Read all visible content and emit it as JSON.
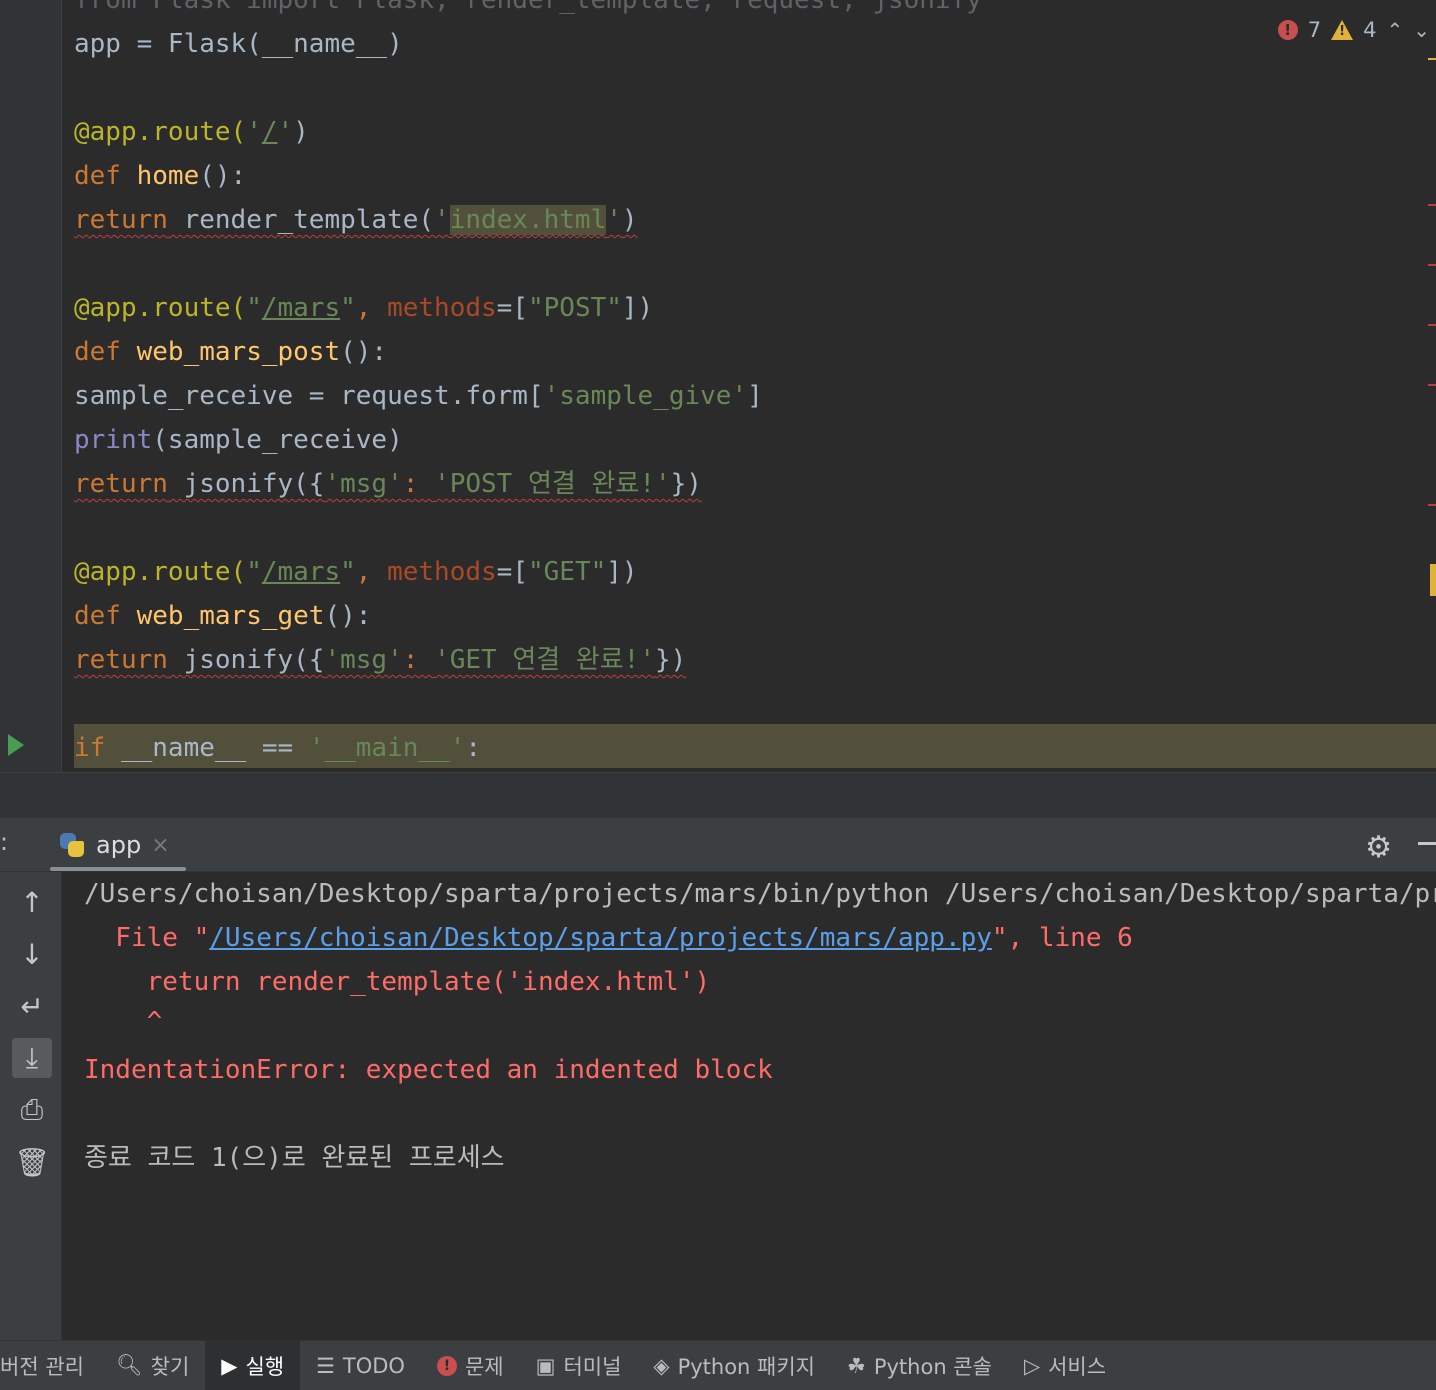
{
  "editor": {
    "lines": [
      {
        "segments": [
          {
            "t": "from Flask import Flask, render_template, request, jsonify",
            "c": "ghost"
          }
        ]
      },
      {
        "segments": [
          {
            "t": "app = Flask(__name__)",
            "c": "op"
          }
        ]
      },
      {
        "segments": []
      },
      {
        "segments": [
          {
            "t": "@app.route(",
            "c": "dec"
          },
          {
            "t": "'",
            "c": "str"
          },
          {
            "t": "/",
            "c": "str url"
          },
          {
            "t": "'",
            "c": "str"
          },
          {
            "t": ")",
            "c": "op"
          }
        ]
      },
      {
        "segments": [
          {
            "t": "def ",
            "c": "kw"
          },
          {
            "t": "home",
            "c": "fn"
          },
          {
            "t": "():",
            "c": "op"
          }
        ]
      },
      {
        "segments": [
          {
            "t": "return",
            "c": "kw squig"
          },
          {
            "t": " render_template(",
            "c": "op squig"
          },
          {
            "t": "'",
            "c": "str squig"
          },
          {
            "t": "index.html",
            "c": "str squig hlword"
          },
          {
            "t": "'",
            "c": "str squig"
          },
          {
            "t": ")",
            "c": "op squig"
          }
        ]
      },
      {
        "segments": []
      },
      {
        "segments": [
          {
            "t": "@app.route(",
            "c": "dec"
          },
          {
            "t": "\"",
            "c": "str"
          },
          {
            "t": "/mars",
            "c": "str url"
          },
          {
            "t": "\"",
            "c": "str"
          },
          {
            "t": ", ",
            "c": "kw"
          },
          {
            "t": "methods",
            "c": "param"
          },
          {
            "t": "=[",
            "c": "op"
          },
          {
            "t": "\"POST\"",
            "c": "str"
          },
          {
            "t": "])",
            "c": "op"
          }
        ]
      },
      {
        "segments": [
          {
            "t": "def ",
            "c": "kw"
          },
          {
            "t": "web_mars_post",
            "c": "fn"
          },
          {
            "t": "():",
            "c": "op"
          }
        ]
      },
      {
        "segments": [
          {
            "t": "sample_receive",
            "c": "op"
          },
          {
            "t": " = request.form[",
            "c": "op"
          },
          {
            "t": "'sample_give'",
            "c": "str"
          },
          {
            "t": "]",
            "c": "op"
          }
        ]
      },
      {
        "segments": [
          {
            "t": "print",
            "c": "bi"
          },
          {
            "t": "(sample_receive)",
            "c": "op"
          }
        ]
      },
      {
        "segments": [
          {
            "t": "return",
            "c": "kw squig"
          },
          {
            "t": " jsonify({",
            "c": "op squig"
          },
          {
            "t": "'msg'",
            "c": "str squig"
          },
          {
            "t": ": ",
            "c": "kw squig"
          },
          {
            "t": "'POST 연결 완료!'",
            "c": "str squig"
          },
          {
            "t": "})",
            "c": "op squig"
          }
        ]
      },
      {
        "segments": []
      },
      {
        "segments": [
          {
            "t": "@app.route(",
            "c": "dec"
          },
          {
            "t": "\"",
            "c": "str"
          },
          {
            "t": "/mars",
            "c": "str url"
          },
          {
            "t": "\"",
            "c": "str"
          },
          {
            "t": ", ",
            "c": "kw"
          },
          {
            "t": "methods",
            "c": "param"
          },
          {
            "t": "=[",
            "c": "op"
          },
          {
            "t": "\"GET\"",
            "c": "str"
          },
          {
            "t": "])",
            "c": "op"
          }
        ]
      },
      {
        "segments": [
          {
            "t": "def ",
            "c": "kw"
          },
          {
            "t": "web_mars_get",
            "c": "fn"
          },
          {
            "t": "():",
            "c": "op"
          }
        ]
      },
      {
        "segments": [
          {
            "t": "return",
            "c": "kw squig"
          },
          {
            "t": " jsonify({",
            "c": "op squig"
          },
          {
            "t": "'msg'",
            "c": "str squig"
          },
          {
            "t": ": ",
            "c": "kw squig"
          },
          {
            "t": "'GET 연결 완료!'",
            "c": "str squig"
          },
          {
            "t": "})",
            "c": "op squig"
          }
        ]
      },
      {
        "segments": []
      },
      {
        "segments": [
          {
            "t": "if ",
            "c": "kw"
          },
          {
            "t": "__name__ == ",
            "c": "op"
          },
          {
            "t": "'__main__'",
            "c": "str"
          },
          {
            "t": ":",
            "c": "op"
          }
        ]
      }
    ],
    "inspection": {
      "errors": "7",
      "warnings": "4",
      "up_icon": "chevron-up-icon",
      "down_icon": "chevron-down-icon"
    }
  },
  "run_panel": {
    "prefix": ":",
    "tab_label": "app",
    "tab_close": "×",
    "toolbar": [
      "arrow-up-icon",
      "arrow-down-icon",
      "soft-wrap-icon",
      "scroll-to-end-icon",
      "print-icon",
      "trash-icon"
    ],
    "output": {
      "command": "/Users/choisan/Desktop/sparta/projects/mars/bin/python /Users/choisan/Desktop/sparta/projects/mars/app.py",
      "file_prefix": "  File \"",
      "file_path": "/Users/choisan/Desktop/sparta/projects/mars/app.py",
      "file_suffix": "\", line 6",
      "code_line": "    return render_template('index.html')",
      "caret": "    ^",
      "error": "IndentationError: expected an indented block",
      "exit": "종료 코드 1(으)로 완료된 프로세스"
    }
  },
  "statusbar": {
    "items": [
      {
        "label": "버전 관리",
        "icon": ""
      },
      {
        "label": "찾기",
        "icon": "search-icon"
      },
      {
        "label": "실행",
        "icon": "run-icon",
        "active": true
      },
      {
        "label": "TODO",
        "icon": "list-icon"
      },
      {
        "label": "문제",
        "icon": "error-icon"
      },
      {
        "label": "터미널",
        "icon": "terminal-icon"
      },
      {
        "label": "Python 패키지",
        "icon": "layers-icon"
      },
      {
        "label": "Python 콘솔",
        "icon": "python-icon"
      },
      {
        "label": "서비스",
        "icon": "services-icon"
      }
    ]
  },
  "colors": {
    "error": "#ff6b68",
    "link": "#5a9fe8",
    "keyword": "#cc7832",
    "string": "#6a8759",
    "function": "#ffc66d"
  }
}
